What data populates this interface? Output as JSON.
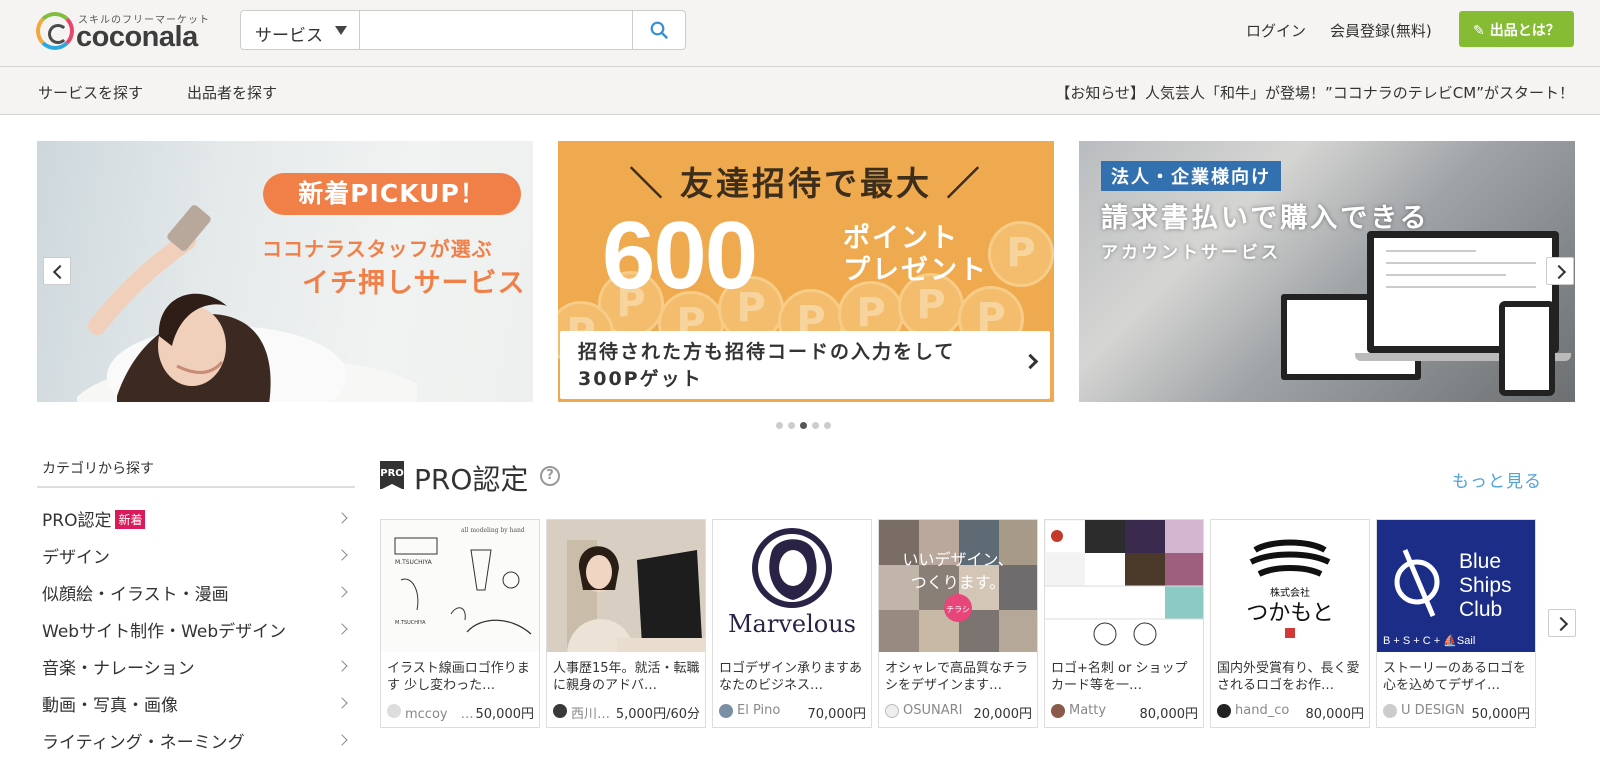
{
  "header": {
    "logo_tagline": "スキルのフリーマーケット",
    "logo_text": "coconala",
    "search_category": "サービス",
    "search_value": "",
    "login": "ログイン",
    "register": "会員登録(無料)",
    "sell": "出品とは？"
  },
  "subnav": {
    "find_services": "サービスを探す",
    "find_sellers": "出品者を探す",
    "notice": "【お知らせ】人気芸人「和牛」が登場！”ココナラのテレビCM”がスタート！"
  },
  "banners": [
    {
      "badge": "新着PICKUP！",
      "line1": "ココナラスタッフが選ぶ",
      "line2": "イチ押しサービス"
    },
    {
      "headline": "＼ 友達招待で最大 ／",
      "amount": "600",
      "point_text_1": "ポイント",
      "point_text_2": "プレゼント",
      "sub_line1": "招待された方も招待コードの入力をして",
      "sub_line2": "300Pゲット"
    },
    {
      "badge": "法人・企業様向け",
      "title": "請求書払いで購入できる",
      "subtitle": "アカウントサービス"
    }
  ],
  "carousel": {
    "total": 5,
    "active": 3
  },
  "sidebar": {
    "title": "カテゴリから探す",
    "new_badge": "新着",
    "items": [
      {
        "label": "PRO認定"
      },
      {
        "label": "デザイン"
      },
      {
        "label": "似顔絵・イラスト・漫画"
      },
      {
        "label": "Webサイト制作・Webデザイン"
      },
      {
        "label": "音楽・ナレーション"
      },
      {
        "label": "動画・写真・画像"
      },
      {
        "label": "ライティング・ネーミング"
      }
    ]
  },
  "pro_section": {
    "icon_text": "PRO",
    "title": "PRO認定",
    "more": "もっと見る",
    "cards": [
      {
        "title": "イラスト線画ロゴ作ります 少し変わった…",
        "user": "mccoy　…",
        "price": "50,000円",
        "avatar_color": "#dddddd"
      },
      {
        "title": "人事歴15年。就活・転職に親身のアドバ…",
        "user": "西川…",
        "price": "5,000円/60分",
        "avatar_color": "#3a3a3a"
      },
      {
        "title": "ロゴデザイン承りますあなたのビジネス…",
        "user": "El Pino",
        "price": "70,000円",
        "avatar_color": "#7a8fa3"
      },
      {
        "title": "オシャレで高品質なチラシをデザインます…",
        "user": "OSUNARI",
        "price": "20,000円",
        "avatar_color": "#eeeeee"
      },
      {
        "title": "ロゴ+名刺 or ショップカード等を一…",
        "user": "Matty",
        "price": "80,000円",
        "avatar_color": "#8a5a4a"
      },
      {
        "title": "国内外受賞有り、長く愛されるロゴをお作…",
        "user": "hand_co",
        "price": "80,000円",
        "avatar_color": "#222222"
      },
      {
        "title": "ストーリーのあるロゴを心を込めてデザイ…",
        "user": "U DESIGN",
        "price": "50,000円",
        "avatar_color": "#cccccc"
      }
    ],
    "thumb_texts": {
      "c1_sig1": "all modeling by hand",
      "c1_sig2": "M.TSUCHIYA",
      "c3_logo": "Marvelous",
      "c4_line1": "いいデザイン、",
      "c4_line2": "つくります。",
      "c4_badge": "チラシ",
      "c6_company": "株式会社",
      "c6_name": "つかもと",
      "c7_line1": "Blue",
      "c7_line2": "Ships",
      "c7_line3": "Club",
      "c7_footer": "B + S + C + ⛵Sail"
    }
  },
  "colors": {
    "accent_green": "#86bc34",
    "link_blue": "#4fa3d7",
    "new_badge": "#d91b5c",
    "banner_orange": "#efa94f",
    "pickup_orange": "#f07f48",
    "corp_blue": "#3370b0"
  }
}
